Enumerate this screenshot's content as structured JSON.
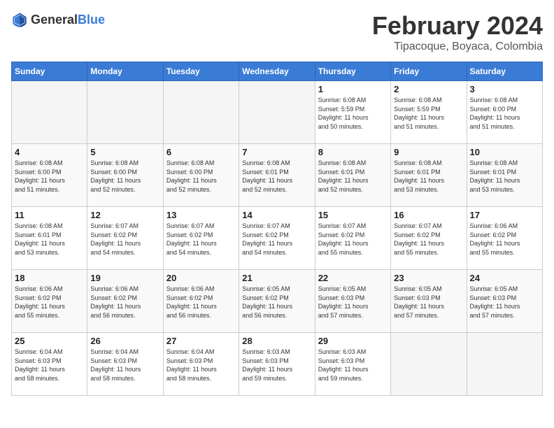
{
  "header": {
    "logo_general": "General",
    "logo_blue": "Blue",
    "title": "February 2024",
    "subtitle": "Tipacoque, Boyaca, Colombia"
  },
  "weekdays": [
    "Sunday",
    "Monday",
    "Tuesday",
    "Wednesday",
    "Thursday",
    "Friday",
    "Saturday"
  ],
  "weeks": [
    [
      {
        "day": "",
        "info": ""
      },
      {
        "day": "",
        "info": ""
      },
      {
        "day": "",
        "info": ""
      },
      {
        "day": "",
        "info": ""
      },
      {
        "day": "1",
        "info": "Sunrise: 6:08 AM\nSunset: 5:59 PM\nDaylight: 11 hours\nand 50 minutes."
      },
      {
        "day": "2",
        "info": "Sunrise: 6:08 AM\nSunset: 5:59 PM\nDaylight: 11 hours\nand 51 minutes."
      },
      {
        "day": "3",
        "info": "Sunrise: 6:08 AM\nSunset: 6:00 PM\nDaylight: 11 hours\nand 51 minutes."
      }
    ],
    [
      {
        "day": "4",
        "info": "Sunrise: 6:08 AM\nSunset: 6:00 PM\nDaylight: 11 hours\nand 51 minutes."
      },
      {
        "day": "5",
        "info": "Sunrise: 6:08 AM\nSunset: 6:00 PM\nDaylight: 11 hours\nand 52 minutes."
      },
      {
        "day": "6",
        "info": "Sunrise: 6:08 AM\nSunset: 6:00 PM\nDaylight: 11 hours\nand 52 minutes."
      },
      {
        "day": "7",
        "info": "Sunrise: 6:08 AM\nSunset: 6:01 PM\nDaylight: 11 hours\nand 52 minutes."
      },
      {
        "day": "8",
        "info": "Sunrise: 6:08 AM\nSunset: 6:01 PM\nDaylight: 11 hours\nand 52 minutes."
      },
      {
        "day": "9",
        "info": "Sunrise: 6:08 AM\nSunset: 6:01 PM\nDaylight: 11 hours\nand 53 minutes."
      },
      {
        "day": "10",
        "info": "Sunrise: 6:08 AM\nSunset: 6:01 PM\nDaylight: 11 hours\nand 53 minutes."
      }
    ],
    [
      {
        "day": "11",
        "info": "Sunrise: 6:08 AM\nSunset: 6:01 PM\nDaylight: 11 hours\nand 53 minutes."
      },
      {
        "day": "12",
        "info": "Sunrise: 6:07 AM\nSunset: 6:02 PM\nDaylight: 11 hours\nand 54 minutes."
      },
      {
        "day": "13",
        "info": "Sunrise: 6:07 AM\nSunset: 6:02 PM\nDaylight: 11 hours\nand 54 minutes."
      },
      {
        "day": "14",
        "info": "Sunrise: 6:07 AM\nSunset: 6:02 PM\nDaylight: 11 hours\nand 54 minutes."
      },
      {
        "day": "15",
        "info": "Sunrise: 6:07 AM\nSunset: 6:02 PM\nDaylight: 11 hours\nand 55 minutes."
      },
      {
        "day": "16",
        "info": "Sunrise: 6:07 AM\nSunset: 6:02 PM\nDaylight: 11 hours\nand 55 minutes."
      },
      {
        "day": "17",
        "info": "Sunrise: 6:06 AM\nSunset: 6:02 PM\nDaylight: 11 hours\nand 55 minutes."
      }
    ],
    [
      {
        "day": "18",
        "info": "Sunrise: 6:06 AM\nSunset: 6:02 PM\nDaylight: 11 hours\nand 55 minutes."
      },
      {
        "day": "19",
        "info": "Sunrise: 6:06 AM\nSunset: 6:02 PM\nDaylight: 11 hours\nand 56 minutes."
      },
      {
        "day": "20",
        "info": "Sunrise: 6:06 AM\nSunset: 6:02 PM\nDaylight: 11 hours\nand 56 minutes."
      },
      {
        "day": "21",
        "info": "Sunrise: 6:05 AM\nSunset: 6:02 PM\nDaylight: 11 hours\nand 56 minutes."
      },
      {
        "day": "22",
        "info": "Sunrise: 6:05 AM\nSunset: 6:03 PM\nDaylight: 11 hours\nand 57 minutes."
      },
      {
        "day": "23",
        "info": "Sunrise: 6:05 AM\nSunset: 6:03 PM\nDaylight: 11 hours\nand 57 minutes."
      },
      {
        "day": "24",
        "info": "Sunrise: 6:05 AM\nSunset: 6:03 PM\nDaylight: 11 hours\nand 57 minutes."
      }
    ],
    [
      {
        "day": "25",
        "info": "Sunrise: 6:04 AM\nSunset: 6:03 PM\nDaylight: 11 hours\nand 58 minutes."
      },
      {
        "day": "26",
        "info": "Sunrise: 6:04 AM\nSunset: 6:03 PM\nDaylight: 11 hours\nand 58 minutes."
      },
      {
        "day": "27",
        "info": "Sunrise: 6:04 AM\nSunset: 6:03 PM\nDaylight: 11 hours\nand 58 minutes."
      },
      {
        "day": "28",
        "info": "Sunrise: 6:03 AM\nSunset: 6:03 PM\nDaylight: 11 hours\nand 59 minutes."
      },
      {
        "day": "29",
        "info": "Sunrise: 6:03 AM\nSunset: 6:03 PM\nDaylight: 11 hours\nand 59 minutes."
      },
      {
        "day": "",
        "info": ""
      },
      {
        "day": "",
        "info": ""
      }
    ]
  ]
}
